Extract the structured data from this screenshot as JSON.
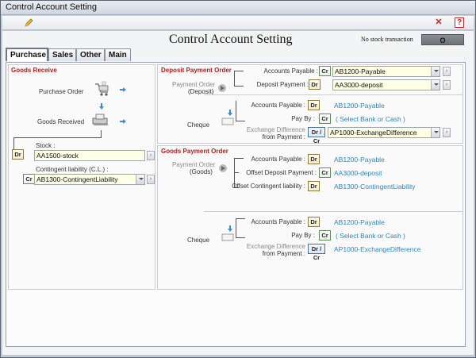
{
  "window": {
    "title": "Control Account Setting"
  },
  "toolbar": {
    "edit_icon": "pencil-icon",
    "close_icon": "close-icon",
    "help_icon": "help-icon",
    "help_label": "?",
    "close_label": "✕"
  },
  "header": {
    "title": "Control Account Setting",
    "no_stock_label": "No stock transaction",
    "no_stock_value": "O"
  },
  "tabs": [
    {
      "label": "Purchase",
      "active": true
    },
    {
      "label": "Sales"
    },
    {
      "label": "Other"
    },
    {
      "label": "Main"
    }
  ],
  "goods_receive": {
    "title": "Goods Receive",
    "purchase_order": "Purchase Order",
    "goods_received": "Goods Received",
    "stock_label": "Stock :",
    "stock_tag": "Dr",
    "stock_value": "AA1500-stock",
    "cl_label": "Contingent liability (C.L.) :",
    "cl_tag": "Cr",
    "cl_value": "AB1300-ContingentLiability"
  },
  "deposit_payment_order": {
    "title": "Deposit Payment Order",
    "po_label_1": "Payment Order",
    "po_label_2": "(Deposit)",
    "ap_label": "Accounts Payable :",
    "ap_tag": "Cr",
    "ap_value": "AB1200-Payable",
    "dp_label": "Deposit Payment :",
    "dp_tag": "Dr",
    "dp_value": "AA3000-deposit",
    "cheque_label": "Cheque",
    "ch_ap_label": "Accounts Payable :",
    "ch_ap_tag": "Dr",
    "ch_ap_value": "AB1200-Payable",
    "payby_label": "Pay By :",
    "payby_tag": "Cr",
    "payby_value": "( Select Bank or Cash )",
    "exdiff_label_1": "Exchange Difference",
    "exdiff_label_2": "from Payment :",
    "exdiff_tag": "Dr / Cr",
    "exdiff_value": "AP1000-ExchangeDifference"
  },
  "goods_payment_order": {
    "title": "Goods Payment Order",
    "po_label_1": "Payment Order",
    "po_label_2": "(Goods)",
    "ap_label": "Accounts Payable :",
    "ap_tag": "Dr",
    "ap_value": "AB1200-Payable",
    "odp_label": "Offset Deposit Payment :",
    "odp_tag": "Cr",
    "odp_value": "AA3000-deposit",
    "ocl_label": "Offset Contingent liability :",
    "ocl_tag": "Dr",
    "ocl_value": "AB1300-ContingentLiability",
    "cheque_label": "Cheque",
    "ch_ap_label": "Accounts Payable :",
    "ch_ap_tag": "Dr",
    "ch_ap_value": "AB1200-Payable",
    "payby_label": "Pay By :",
    "payby_tag": "Cr",
    "payby_value": "( Select Bank or Cash )",
    "exdiff_label_1": "Exchange Difference",
    "exdiff_label_2": "from Payment :",
    "exdiff_tag": "Dr / Cr",
    "exdiff_value": "AP1000-ExchangeDifference"
  },
  "colors": {
    "section_title": "#b31b1b",
    "account_link": "#2a86b6",
    "field_bg": "#ffffe6",
    "flow_arrow": "#3f8ad1"
  }
}
